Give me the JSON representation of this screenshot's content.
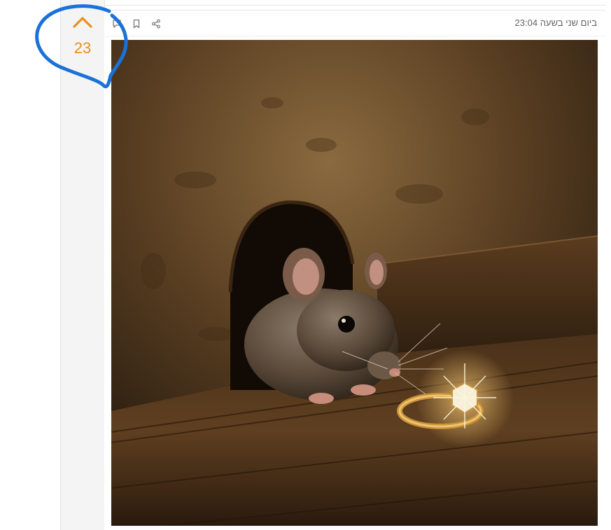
{
  "vote": {
    "count": "23",
    "color": "#e8901c"
  },
  "post": {
    "timestamp": "ביום שני בשעה 23:04",
    "toolbar_icons": [
      "comment-icon",
      "bookmark-icon",
      "share-icon"
    ]
  },
  "image": {
    "alt": "Mouse peeking out of a hole beside a diamond ring on wooden floor"
  },
  "colors": {
    "accent": "#e8901c",
    "highlight_ink": "#1a72d8"
  }
}
